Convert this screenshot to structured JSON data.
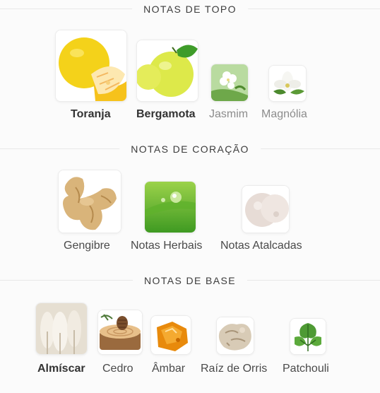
{
  "sections": [
    {
      "heading": "NOTAS DE TOPO",
      "notes": [
        {
          "label": "Toranja",
          "icon": "grapefruit-icon",
          "emphasis": "strong"
        },
        {
          "label": "Bergamota",
          "icon": "bergamot-icon",
          "emphasis": "strong"
        },
        {
          "label": "Jasmim",
          "icon": "jasmine-icon",
          "emphasis": "dim"
        },
        {
          "label": "Magnólia",
          "icon": "magnolia-icon",
          "emphasis": "dim"
        }
      ]
    },
    {
      "heading": "NOTAS DE CORAÇÃO",
      "notes": [
        {
          "label": "Gengibre",
          "icon": "ginger-icon",
          "emphasis": "mid"
        },
        {
          "label": "Notas Herbais",
          "icon": "herbal-leaf-icon",
          "emphasis": "mid"
        },
        {
          "label": "Notas Atalcadas",
          "icon": "powder-icon",
          "emphasis": "mid"
        }
      ]
    },
    {
      "heading": "NOTAS DE BASE",
      "notes": [
        {
          "label": "Almíscar",
          "icon": "musk-icon",
          "emphasis": "strong"
        },
        {
          "label": "Cedro",
          "icon": "cedar-icon",
          "emphasis": "mid"
        },
        {
          "label": "Âmbar",
          "icon": "amber-icon",
          "emphasis": "mid"
        },
        {
          "label": "Raíz de Orris",
          "icon": "orris-root-icon",
          "emphasis": "mid"
        },
        {
          "label": "Patchouli",
          "icon": "patchouli-icon",
          "emphasis": "mid"
        }
      ]
    }
  ]
}
